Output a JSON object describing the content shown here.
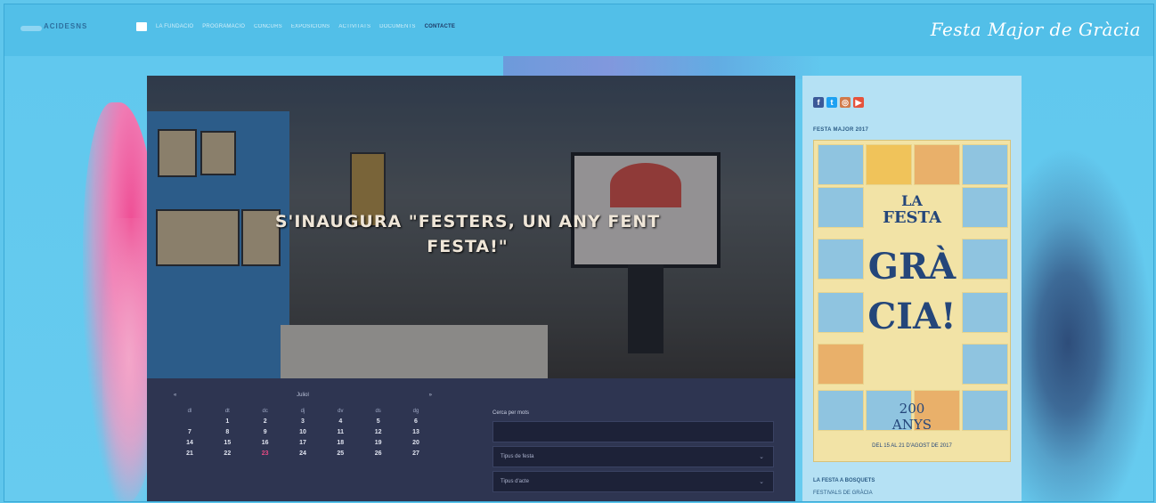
{
  "header": {
    "logo_text": "ACIDESNS",
    "nav_items": [
      "LA FUNDACIÓ",
      "PROGRAMACIÓ",
      "CONCURS",
      "EXPOSICIONS",
      "ACTIVITATS",
      "DOCUMENTS",
      "CONTACTE"
    ],
    "festa_title": "Festa Major de Gràcia"
  },
  "hero": {
    "title": "S'INAUGURA \"FESTERS, UN ANY FENT FESTA!\""
  },
  "calendar": {
    "prev": "«",
    "month": "Juliol",
    "next": "»",
    "weekdays": [
      "dl",
      "dt",
      "dc",
      "dj",
      "dv",
      "ds",
      "dg"
    ],
    "weeks": [
      [
        "",
        "1",
        "2",
        "3",
        "4",
        "5",
        "6"
      ],
      [
        "7",
        "8",
        "9",
        "10",
        "11",
        "12",
        "13"
      ],
      [
        "14",
        "15",
        "16",
        "17",
        "18",
        "19",
        "20"
      ],
      [
        "21",
        "22",
        "23",
        "24",
        "25",
        "26",
        "27"
      ]
    ],
    "today": "23"
  },
  "search": {
    "label": "Cerca per mots",
    "type_select": "Tipus de festa",
    "year_select": "Tipus d'acte"
  },
  "sidebar": {
    "social_icons": [
      "facebook-icon",
      "twitter-icon",
      "instagram-icon",
      "youtube-icon"
    ],
    "section_label": "FESTA MAJOR 2017",
    "poster_words": [
      "LA",
      "FESTA",
      "GRÀ",
      "CIA!"
    ],
    "poster_years": "200 ANYS",
    "poster_footer": "DEL 15 AL 21 D'AGOST DE 2017",
    "links": [
      "LA FESTA A BOSQUETS",
      "FESTIVALS DE GRÀCIA"
    ]
  },
  "colors": {
    "background": "#5fc6ec",
    "panel": "#2e3551",
    "accent_pink": "#e84a84"
  }
}
